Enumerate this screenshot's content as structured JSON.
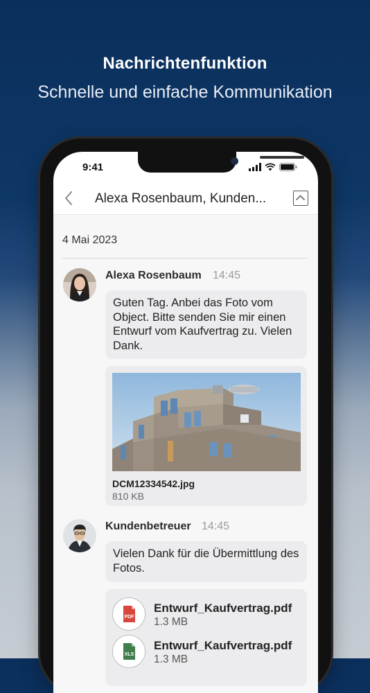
{
  "hero": {
    "title": "Nachrichtenfunktion",
    "subtitle": "Schnelle und einfache Kommunikation"
  },
  "status_bar": {
    "time": "9:41",
    "icons": [
      "signal-icon",
      "wifi-icon",
      "battery-icon"
    ]
  },
  "header": {
    "back_icon": "chevron-left-icon",
    "title": "Alexa Rosenbaum, Kunden...",
    "collapse_icon": "chevron-up-icon"
  },
  "chat": {
    "date": "4 Mai 2023",
    "messages": [
      {
        "sender": "Alexa Rosenbaum",
        "time": "14:45",
        "text": "Guten Tag. Anbei das Foto vom Object. Bitte senden Sie mir einen Entwurf vom Kaufvertrag zu. Vielen Dank.",
        "attachment": {
          "filename": "DCM12334542.jpg",
          "size": "810 KB"
        }
      },
      {
        "sender": "Kundenbetreuer",
        "time": "14:45",
        "text": "Vielen Dank für die Übermittlung des Fotos.",
        "files": [
          {
            "icon": "pdf-file-icon",
            "badge": "PDF",
            "filename": "Entwurf_Kaufvertrag.pdf",
            "size": "1.3 MB"
          },
          {
            "icon": "xls-file-icon",
            "badge": "XLS",
            "filename": "Entwurf_Kaufvertrag.pdf",
            "size": "1.3 MB"
          }
        ]
      }
    ]
  },
  "colors": {
    "background_top": "#0b2f5c",
    "bubble": "#ececee",
    "pdf": "#d9473c",
    "xls": "#3f7d4b"
  }
}
